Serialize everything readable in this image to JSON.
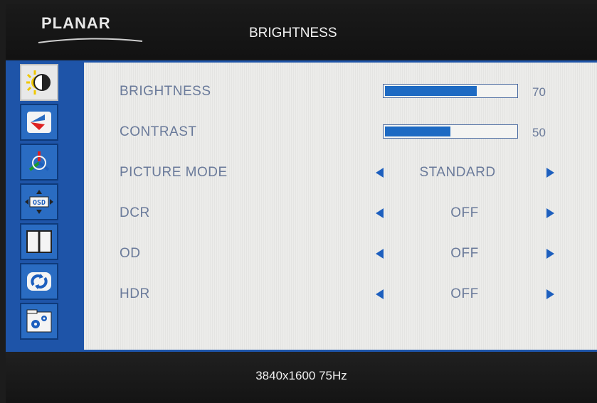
{
  "header": {
    "logo": "PLANAR",
    "title": "BRIGHTNESS"
  },
  "sidebar": {
    "items": [
      {
        "icon": "brightness-icon",
        "active": true
      },
      {
        "icon": "color-icon"
      },
      {
        "icon": "picture-icon"
      },
      {
        "icon": "osd-icon"
      },
      {
        "icon": "pip-icon"
      },
      {
        "icon": "reset-icon"
      },
      {
        "icon": "settings-icon"
      }
    ]
  },
  "rows": {
    "brightness": {
      "label": "BRIGHTNESS",
      "value": "70",
      "level": 0.7
    },
    "contrast": {
      "label": "CONTRAST",
      "value": "50",
      "level": 0.5
    },
    "picture_mode": {
      "label": "PICTURE MODE",
      "value": "STANDARD"
    },
    "dcr": {
      "label": "DCR",
      "value": "OFF"
    },
    "od": {
      "label": "OD",
      "value": "OFF"
    },
    "hdr": {
      "label": "HDR",
      "value": "OFF"
    }
  },
  "footer": {
    "resolution": "3840x1600  75Hz"
  },
  "colors": {
    "accent": "#1d6ac3",
    "text": "#6a7a9a",
    "frame": "#1e54a8"
  }
}
